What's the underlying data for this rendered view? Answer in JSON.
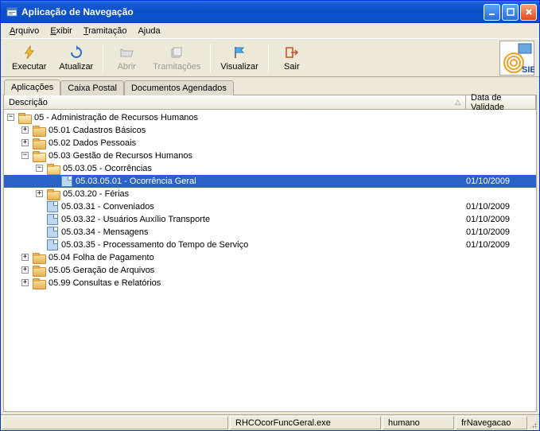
{
  "window": {
    "title": "Aplicação de Navegação"
  },
  "menu": {
    "arquivo": "Arquivo",
    "exibir": "Exibir",
    "tramitacao": "Tramitação",
    "ajuda": "Ajuda"
  },
  "toolbar": {
    "executar": "Executar",
    "atualizar": "Atualizar",
    "abrir": "Abrir",
    "tramitacoes": "Tramitações",
    "visualizar": "Visualizar",
    "sair": "Sair"
  },
  "tabs": {
    "aplicacoes": "Aplicações",
    "caixa_postal": "Caixa Postal",
    "documentos": "Documentos Agendados"
  },
  "columns": {
    "descricao": "Descrição",
    "validade": "Data de Validade"
  },
  "tree": {
    "n05": "05 - Administração de Recursos Humanos",
    "n0501": "05.01 Cadastros Básicos",
    "n0502": "05.02 Dados Pessoais",
    "n0503": "05.03 Gestão de Recursos Humanos",
    "n050305": "05.03.05 - Ocorrências",
    "n05030501": "05.03.05.01 - Ocorrência Geral",
    "n050320": "05.03.20 - Férias",
    "n050331": "05.03.31 - Conveniados",
    "n050332": "05.03.32 - Usuários Auxílio Transporte",
    "n050334": "05.03.34 - Mensagens",
    "n050335": "05.03.35 - Processamento do Tempo de Serviço",
    "n0504": "05.04 Folha de Pagamento",
    "n0505": "05.05 Geração de Arquivos",
    "n0599": "05.99 Consultas e Relatórios",
    "d05030501": "01/10/2009",
    "d050331": "01/10/2009",
    "d050332": "01/10/2009",
    "d050334": "01/10/2009",
    "d050335": "01/10/2009"
  },
  "status": {
    "exe": "RHCOcorFuncGeral.exe",
    "user": "humano",
    "form": "frNavegacao"
  },
  "logo_text": "SIE"
}
